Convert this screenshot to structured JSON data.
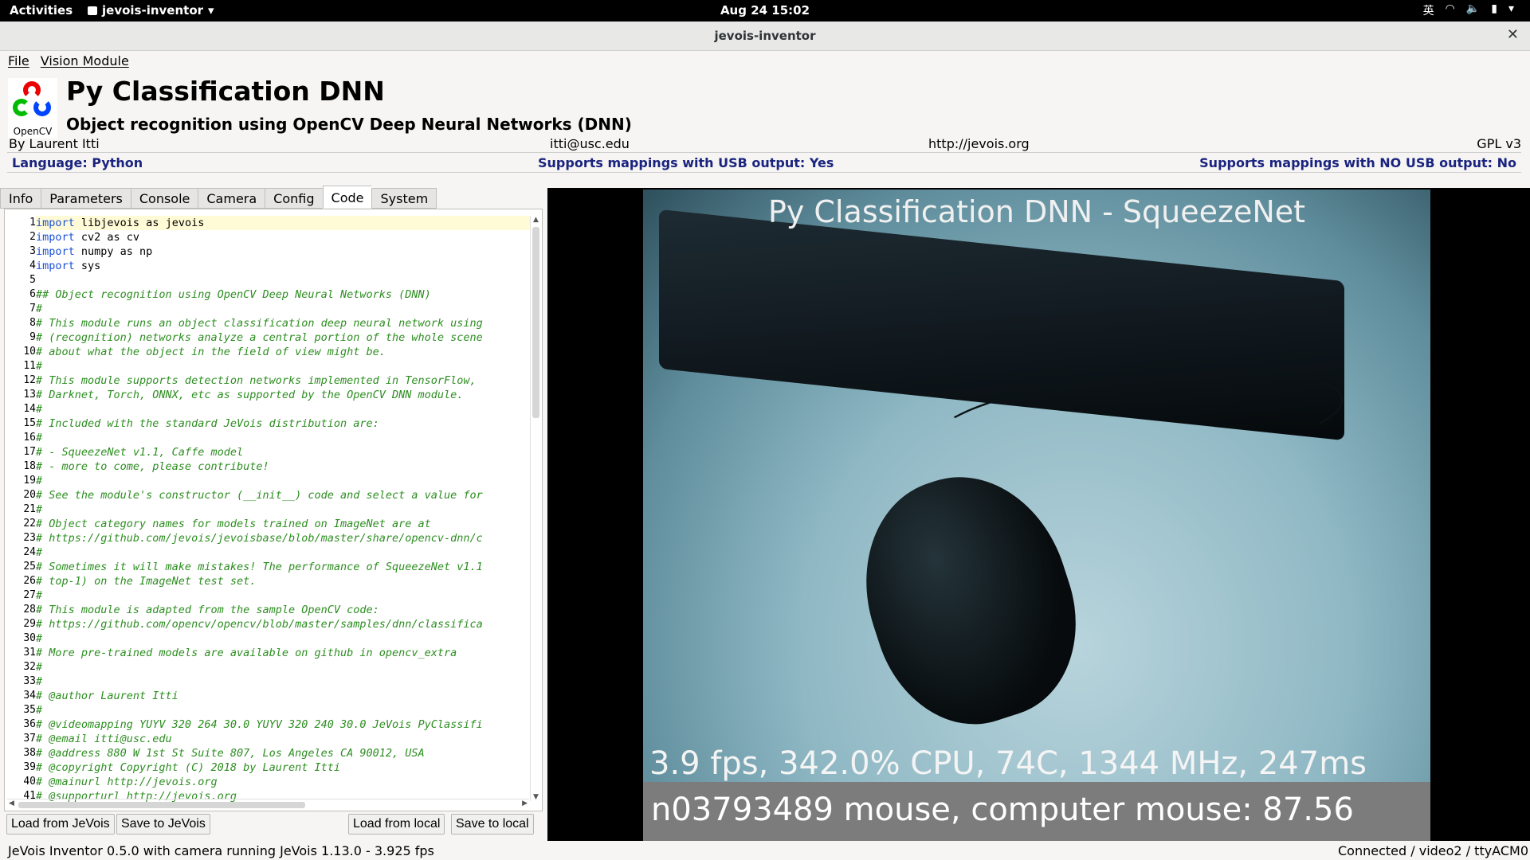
{
  "topbar": {
    "activities": "Activities",
    "app_name": "jevois-inventor",
    "clock": "Aug 24  15:02",
    "input_method": "英"
  },
  "window": {
    "title": "jevois-inventor"
  },
  "menubar": {
    "items": [
      "File",
      "Vision Module"
    ]
  },
  "header": {
    "logo_text": "OpenCV",
    "module_name": "Py Classification DNN",
    "subtitle": "Object recognition using OpenCV Deep Neural Networks (DNN)",
    "author": "By Laurent Itti",
    "email": "itti@usc.edu",
    "website": "http://jevois.org",
    "license": "GPL v3",
    "language": "Language: Python",
    "usb_support": "Supports mappings with USB output: Yes",
    "nousb_support": "Supports mappings with NO USB output: No"
  },
  "tabs": [
    "Info",
    "Parameters",
    "Console",
    "Camera",
    "Config",
    "Code",
    "System"
  ],
  "active_tab": "Code",
  "code": {
    "lines": [
      "import libjevois as jevois",
      "import cv2 as cv",
      "import numpy as np",
      "import sys",
      "",
      "## Object recognition using OpenCV Deep Neural Networks (DNN)",
      "#",
      "# This module runs an object classification deep neural network using",
      "# (recognition) networks analyze a central portion of the whole scene",
      "# about what the object in the field of view might be.",
      "#",
      "# This module supports detection networks implemented in TensorFlow,",
      "# Darknet, Torch, ONNX, etc as supported by the OpenCV DNN module.",
      "#",
      "# Included with the standard JeVois distribution are:",
      "#",
      "# - SqueezeNet v1.1, Caffe model",
      "# - more to come, please contribute!",
      "#",
      "# See the module's constructor (__init__) code and select a value for",
      "#",
      "# Object category names for models trained on ImageNet are at",
      "# https://github.com/jevois/jevoisbase/blob/master/share/opencv-dnn/c",
      "#",
      "# Sometimes it will make mistakes! The performance of SqueezeNet v1.1",
      "# top-1) on the ImageNet test set.",
      "#",
      "# This module is adapted from the sample OpenCV code:",
      "# https://github.com/opencv/opencv/blob/master/samples/dnn/classifica",
      "#",
      "# More pre-trained models are available on github in opencv_extra",
      "#",
      "#",
      "# @author Laurent Itti",
      "#",
      "# @videomapping YUYV 320 264 30.0 YUYV 320 240 30.0 JeVois PyClassifi",
      "# @email itti@usc.edu",
      "# @address 880 W 1st St Suite 807, Los Angeles CA 90012, USA",
      "# @copyright Copyright (C) 2018 by Laurent Itti",
      "# @mainurl http://jevois.org",
      "# @supporturl http://jevois.org"
    ]
  },
  "buttons": {
    "load_jevois": "Load from JeVois",
    "save_jevois": "Save to JeVois",
    "load_local": "Load from local",
    "save_local": "Save to local"
  },
  "video": {
    "overlay_title": "Py Classification DNN - SqueezeNet",
    "stats": "3.9 fps, 342.0% CPU, 74C, 1344 MHz, 247ms",
    "result": "n03793489 mouse, computer mouse: 87.56"
  },
  "statusbar": {
    "left": "JeVois Inventor 0.5.0 with camera running JeVois 1.13.0 - 3.925 fps",
    "right": "Connected / video2 / ttyACM0"
  }
}
